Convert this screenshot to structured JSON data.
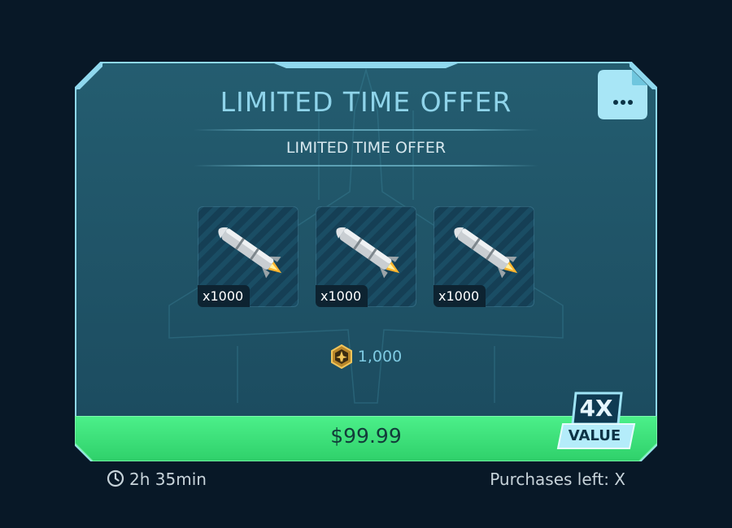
{
  "offer": {
    "title": "LIMITED TIME OFFER",
    "subtitle": "LIMITED TIME OFFER",
    "menu_icon": "ellipsis-icon",
    "items": [
      {
        "icon": "missile-icon",
        "quantity": "x1000"
      },
      {
        "icon": "missile-icon",
        "quantity": "x1000"
      },
      {
        "icon": "missile-icon",
        "quantity": "x1000"
      }
    ],
    "currency": {
      "icon": "jet-coin-icon",
      "amount": "1,000"
    },
    "price": "$99.99",
    "badge": {
      "multiplier": "4X",
      "label": "VALUE"
    }
  },
  "footer": {
    "timer_icon": "clock-icon",
    "time_left": "2h 35min",
    "purchases_left": "Purchases left: X"
  },
  "colors": {
    "background": "#081827",
    "panel": "#1d5366",
    "frame": "#8fd8ee",
    "price_bar": "#3ee07a",
    "title": "#8fd4ea"
  }
}
